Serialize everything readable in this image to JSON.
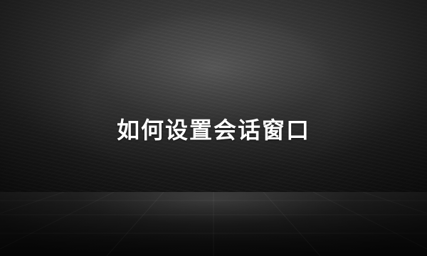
{
  "title": "如何设置会话窗口"
}
